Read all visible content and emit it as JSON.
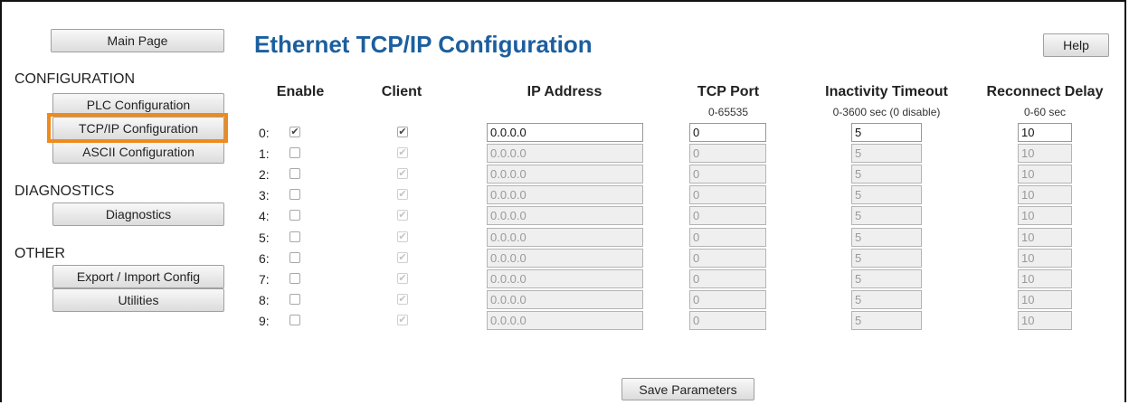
{
  "nav": {
    "main_page": "Main Page",
    "configuration_heading": "CONFIGURATION",
    "plc_config": "PLC Configuration",
    "tcpip_config": "TCP/IP Configuration",
    "ascii_config": "ASCII Configuration",
    "diagnostics_heading": "DIAGNOSTICS",
    "diagnostics": "Diagnostics",
    "other_heading": "OTHER",
    "export_import": "Export / Import Config",
    "utilities": "Utilities"
  },
  "page": {
    "title": "Ethernet TCP/IP Configuration",
    "help": "Help",
    "save": "Save Parameters"
  },
  "columns": {
    "enable": "Enable",
    "client": "Client",
    "ip": "IP Address",
    "port": "TCP Port",
    "port_range": "0-65535",
    "timeout": "Inactivity Timeout",
    "timeout_range": "0-3600 sec (0 disable)",
    "reconnect": "Reconnect Delay",
    "reconnect_range": "0-60 sec"
  },
  "rows": [
    {
      "label": "0:",
      "enable": true,
      "client": true,
      "ip": "0.0.0.0",
      "port": "0",
      "timeout": "5",
      "reconnect": "10",
      "active": true
    },
    {
      "label": "1:",
      "enable": false,
      "client": true,
      "ip": "0.0.0.0",
      "port": "0",
      "timeout": "5",
      "reconnect": "10",
      "active": false
    },
    {
      "label": "2:",
      "enable": false,
      "client": true,
      "ip": "0.0.0.0",
      "port": "0",
      "timeout": "5",
      "reconnect": "10",
      "active": false
    },
    {
      "label": "3:",
      "enable": false,
      "client": true,
      "ip": "0.0.0.0",
      "port": "0",
      "timeout": "5",
      "reconnect": "10",
      "active": false
    },
    {
      "label": "4:",
      "enable": false,
      "client": true,
      "ip": "0.0.0.0",
      "port": "0",
      "timeout": "5",
      "reconnect": "10",
      "active": false
    },
    {
      "label": "5:",
      "enable": false,
      "client": true,
      "ip": "0.0.0.0",
      "port": "0",
      "timeout": "5",
      "reconnect": "10",
      "active": false
    },
    {
      "label": "6:",
      "enable": false,
      "client": true,
      "ip": "0.0.0.0",
      "port": "0",
      "timeout": "5",
      "reconnect": "10",
      "active": false
    },
    {
      "label": "7:",
      "enable": false,
      "client": true,
      "ip": "0.0.0.0",
      "port": "0",
      "timeout": "5",
      "reconnect": "10",
      "active": false
    },
    {
      "label": "8:",
      "enable": false,
      "client": true,
      "ip": "0.0.0.0",
      "port": "0",
      "timeout": "5",
      "reconnect": "10",
      "active": false
    },
    {
      "label": "9:",
      "enable": false,
      "client": true,
      "ip": "0.0.0.0",
      "port": "0",
      "timeout": "5",
      "reconnect": "10",
      "active": false
    }
  ],
  "colors": {
    "title": "#1b5f9f",
    "highlight": "#ef8a1c"
  }
}
